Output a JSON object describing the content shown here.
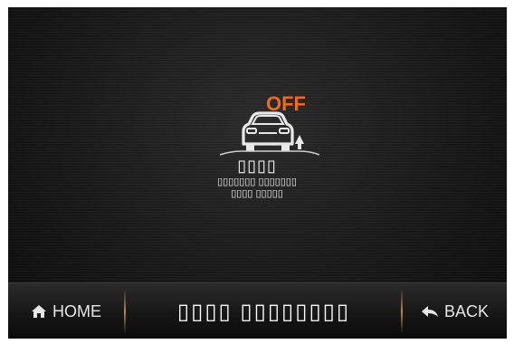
{
  "status": {
    "state": "OFF",
    "icon": "lane-assist-car-icon",
    "title": "▯▯▯▯",
    "description": "▯▯▯▯▯▯▯ ▯▯▯▯▯▯▯\n▯▯▯▯ ▯▯▯▯▯"
  },
  "bottom_bar": {
    "home_label": "HOME",
    "title": "▯▯▯▯ ▯▯▯▯▯▯▯▯",
    "back_label": "BACK"
  },
  "colors": {
    "state_off": "#ef6a1e",
    "divider": "#b68a3c",
    "text": "#ffffff"
  }
}
